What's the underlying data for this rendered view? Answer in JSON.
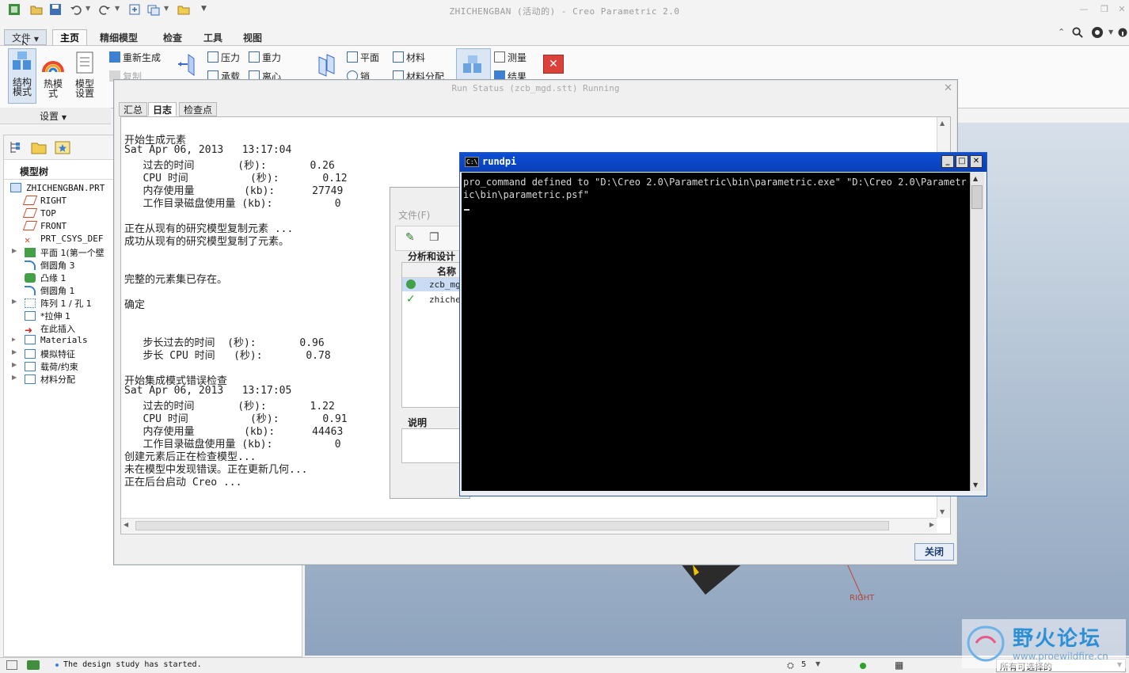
{
  "app": {
    "title": "ZHICHENGBAN (活动的) - Creo Parametric 2.0"
  },
  "ribbon": {
    "file_menu": "文件",
    "tabs": [
      "主页",
      "精细模型",
      "检查",
      "工具",
      "视图"
    ],
    "big_buttons": [
      "结构\n模式",
      "热模\n式",
      "模型\n设置"
    ],
    "group_label": "设置",
    "commands": {
      "regenerate": "重新生成",
      "copy": "复制",
      "pressure": "压力",
      "gravity": "重力",
      "bearing": "承载",
      "centrifugal": "离心",
      "plane": "平面",
      "pin": "销",
      "material": "材料",
      "material_assign": "材料分配",
      "measure": "测量",
      "results": "结果"
    }
  },
  "model_tree": {
    "title": "模型树",
    "root": "ZHICHENGBAN.PRT",
    "items": [
      "RIGHT",
      "TOP",
      "FRONT",
      "PRT_CSYS_DEF",
      "平面 1(第一个壁",
      "倒圆角 3",
      "凸缘 1",
      "倒圆角 1",
      "阵列 1 / 孔 1",
      "*拉伸 1",
      "在此插入",
      "Materials",
      "模拟特征",
      "载荷/约束",
      "材料分配"
    ]
  },
  "run_status": {
    "title": "Run Status (zcb_mgd.stt) Running",
    "tabs": [
      "汇总",
      "日志",
      "检查点"
    ],
    "active_tab": "日志",
    "log_lines": [
      "开始生成元素",
      "Sat Apr 06, 2013   13:17:04",
      "   过去的时间       (秒):       0.26",
      "   CPU 时间          (秒):       0.12",
      "   内存使用量        (kb):      27749",
      "   工作目录磁盘使用量 (kb):          0",
      "",
      "正在从现有的研究模型复制元素 ...",
      "成功从现有的研究模型复制了元素。",
      "",
      "",
      "完整的元素集已存在。",
      "",
      "确定",
      "",
      "",
      "   步长过去的时间  (秒):       0.96",
      "   步长 CPU 时间   (秒):       0.78",
      "",
      "开始集成模式错误检查",
      "Sat Apr 06, 2013   13:17:05",
      "   过去的时间       (秒):       1.22",
      "   CPU 时间          (秒):       0.91",
      "   内存使用量        (kb):      44463",
      "   工作目录磁盘使用量 (kb):          0",
      "创建元素后正在检查模型...",
      "未在模型中发现错误。正在更新几何...",
      "正在后台启动 Creo ..."
    ],
    "close_label": "关闭"
  },
  "mid_dialog": {
    "menu_file": "文件(F)",
    "section_label": "分析和设计",
    "column_name": "名称",
    "rows": [
      "zcb_mg",
      "zhiche"
    ],
    "desc_label": "说明"
  },
  "console": {
    "title": "rundpi",
    "icon_text": "C:\\",
    "text": "pro_command defined to \"D:\\Creo 2.0\\Parametric\\bin\\parametric.exe\" \"D:\\Creo 2.0\\Parametric\\bin\\parametric.psf\""
  },
  "status": {
    "message": "The design study has started.",
    "filter_label": "所有可选择的",
    "count": "5"
  },
  "viewport": {
    "label": "RIGHT"
  },
  "watermark": {
    "text": "野火论坛",
    "url": "www.proewildfire.cn"
  },
  "colors": {
    "accent_blue": "#0b47c9",
    "close_red": "#d9413a",
    "ok_green": "#2aa52a"
  }
}
